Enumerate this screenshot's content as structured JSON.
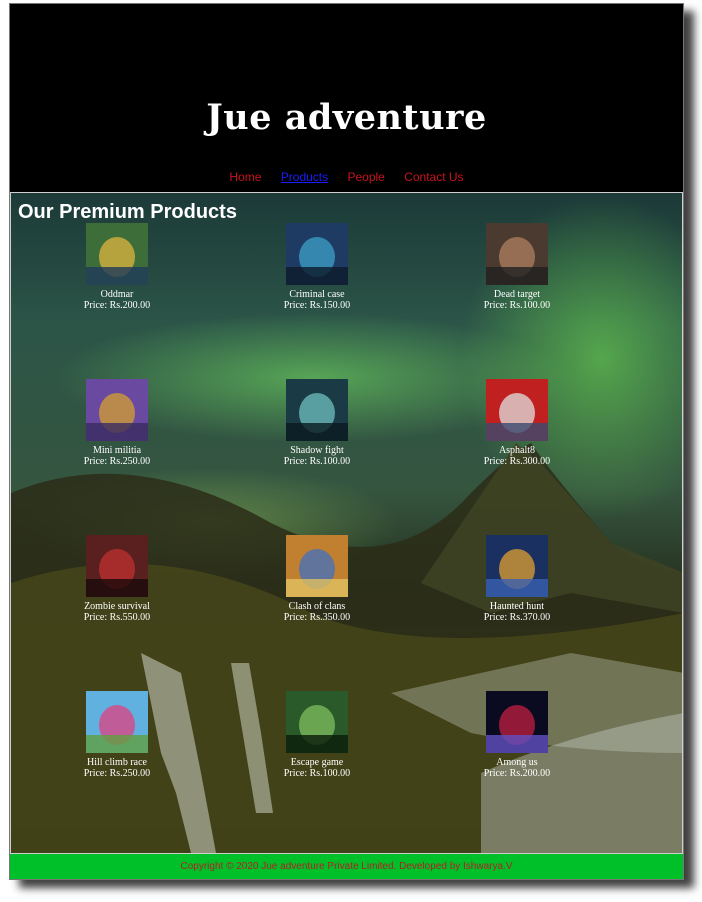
{
  "site": {
    "title": "Jue adventure"
  },
  "nav": [
    {
      "label": "Home",
      "active": false
    },
    {
      "label": "Products",
      "active": true
    },
    {
      "label": "People",
      "active": false
    },
    {
      "label": "Contact Us",
      "active": false
    }
  ],
  "main": {
    "heading": "Our Premium Products"
  },
  "products": [
    {
      "name": "Oddmar",
      "price": "Price: Rs.200.00",
      "colors": [
        "#3d6e3a",
        "#e0b540",
        "#1f3a5a"
      ]
    },
    {
      "name": "Criminal case",
      "price": "Price: Rs.150.00",
      "colors": [
        "#1e3c63",
        "#3fa0c8",
        "#0c1a2a"
      ]
    },
    {
      "name": "Dead target",
      "price": "Price: Rs.100.00",
      "colors": [
        "#4a3a30",
        "#b08060",
        "#202020"
      ]
    },
    {
      "name": "Mini militia",
      "price": "Price: Rs.250.00",
      "colors": [
        "#6a4aa0",
        "#d4a030",
        "#3a2a60"
      ]
    },
    {
      "name": "Shadow fight",
      "price": "Price: Rs.100.00",
      "colors": [
        "#1a3a45",
        "#6fc0c0",
        "#0a1a20"
      ]
    },
    {
      "name": "Asphalt8",
      "price": "Price: Rs.300.00",
      "colors": [
        "#c02020",
        "#e0e0e0",
        "#3a4a70"
      ]
    },
    {
      "name": "Zombie survival",
      "price": "Price: Rs.550.00",
      "colors": [
        "#5a2020",
        "#c03030",
        "#1a0a0a"
      ]
    },
    {
      "name": "Clash of clans",
      "price": "Price: Rs.350.00",
      "colors": [
        "#c08030",
        "#4070c0",
        "#e0c060"
      ]
    },
    {
      "name": "Haunted hunt",
      "price": "Price: Rs.370.00",
      "colors": [
        "#1a3060",
        "#e0a030",
        "#3a60b0"
      ]
    },
    {
      "name": "Hill climb race",
      "price": "Price: Rs.250.00",
      "colors": [
        "#60b0e0",
        "#e04080",
        "#60a040"
      ]
    },
    {
      "name": "Escape game",
      "price": "Price: Rs.100.00",
      "colors": [
        "#2a5a2a",
        "#80c060",
        "#0a1a0a"
      ]
    },
    {
      "name": "Among us",
      "price": "Price: Rs.200.00",
      "colors": [
        "#0a0a20",
        "#c02040",
        "#6050c0"
      ]
    }
  ],
  "footer": {
    "text": "Copyright © 2020 Jue adventure Private Limited. Developed by Ishwarya.V"
  }
}
